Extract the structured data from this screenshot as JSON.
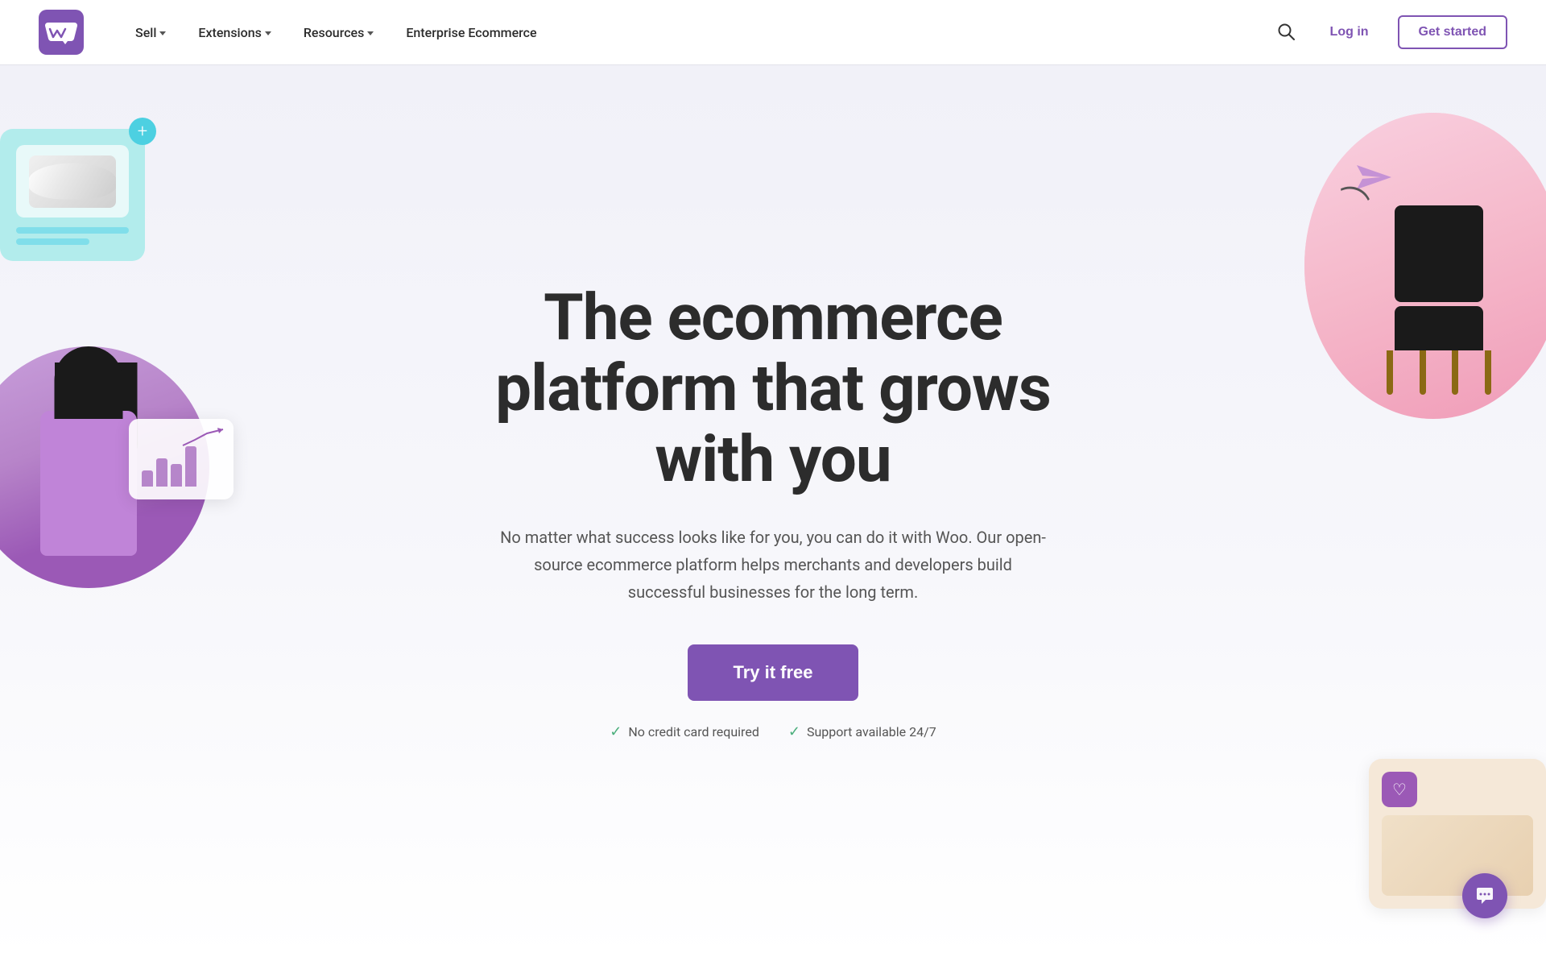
{
  "nav": {
    "logo_alt": "WooCommerce",
    "links": [
      {
        "label": "Sell",
        "has_dropdown": true
      },
      {
        "label": "Extensions",
        "has_dropdown": true
      },
      {
        "label": "Resources",
        "has_dropdown": true
      },
      {
        "label": "Enterprise Ecommerce",
        "has_dropdown": false
      }
    ],
    "login_label": "Log in",
    "get_started_label": "Get started"
  },
  "hero": {
    "title": "The ecommerce platform that grows with you",
    "subtitle": "No matter what success looks like for you, you can do it with Woo. Our open-source ecommerce platform helps merchants and developers build successful businesses for the long term.",
    "cta_label": "Try it free",
    "badge1": "No credit card required",
    "badge2": "Support available 24/7"
  },
  "colors": {
    "brand_purple": "#7f54b3",
    "teal_bg": "#b2ecec",
    "pink_bg": "#f8c8d8",
    "check_green": "#4caf7d"
  },
  "icons": {
    "search": "🔍",
    "check": "✓",
    "plus": "+",
    "heart": "♡",
    "chat": "💬",
    "send": "▷"
  }
}
